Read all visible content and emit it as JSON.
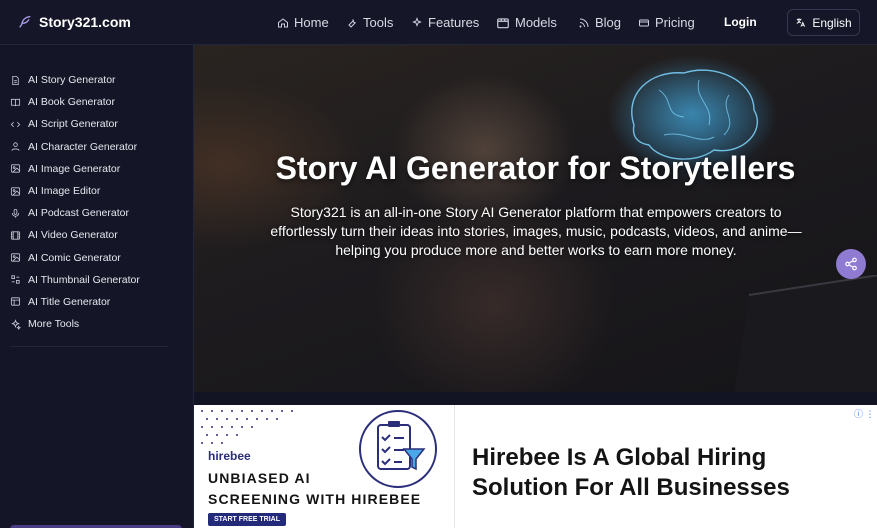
{
  "header": {
    "brand": "Story321.com",
    "nav": [
      {
        "label": "Home",
        "icon": "home-icon"
      },
      {
        "label": "Tools",
        "icon": "wrench-icon"
      },
      {
        "label": "Features",
        "icon": "sparkles-icon"
      },
      {
        "label": "Models",
        "icon": "box-icon"
      },
      {
        "label": "Blog",
        "icon": "rss-icon"
      },
      {
        "label": "Pricing",
        "icon": "card-icon"
      }
    ],
    "login": "Login",
    "language": "English"
  },
  "sidebar": {
    "items": [
      {
        "label": "AI Story Generator",
        "icon": "document-icon"
      },
      {
        "label": "AI Book Generator",
        "icon": "book-icon"
      },
      {
        "label": "AI Script Generator",
        "icon": "code-icon"
      },
      {
        "label": "AI Character Generator",
        "icon": "user-icon"
      },
      {
        "label": "AI Image Generator",
        "icon": "image-icon"
      },
      {
        "label": "AI Image Editor",
        "icon": "image-edit-icon"
      },
      {
        "label": "AI Podcast Generator",
        "icon": "microphone-icon"
      },
      {
        "label": "AI Video Generator",
        "icon": "film-icon"
      },
      {
        "label": "AI Comic Generator",
        "icon": "comic-icon"
      },
      {
        "label": "AI Thumbnail Generator",
        "icon": "thumbnail-icon"
      },
      {
        "label": "AI Title Generator",
        "icon": "title-icon"
      },
      {
        "label": "More Tools",
        "icon": "sparkles-icon"
      }
    ]
  },
  "hero": {
    "title": "Story AI Generator for Storytellers",
    "description": "Story321 is an all-in-one Story AI Generator platform that empowers creators to effortlessly turn their ideas into stories, images, music, podcasts, videos, and anime—helping you produce more and better works to earn more money."
  },
  "ad": {
    "logo": "hirebee",
    "headline_line1": "UNBIASED AI",
    "headline_line2": "SCREENING WITH HIREBEE",
    "cta": "START FREE TRIAL",
    "title_line1": "Hirebee Is A Global Hiring",
    "title_line2": "Solution For All Businesses"
  },
  "colors": {
    "background": "#131423",
    "accent": "#8f7bd1",
    "ad_navy": "#232a7a"
  }
}
